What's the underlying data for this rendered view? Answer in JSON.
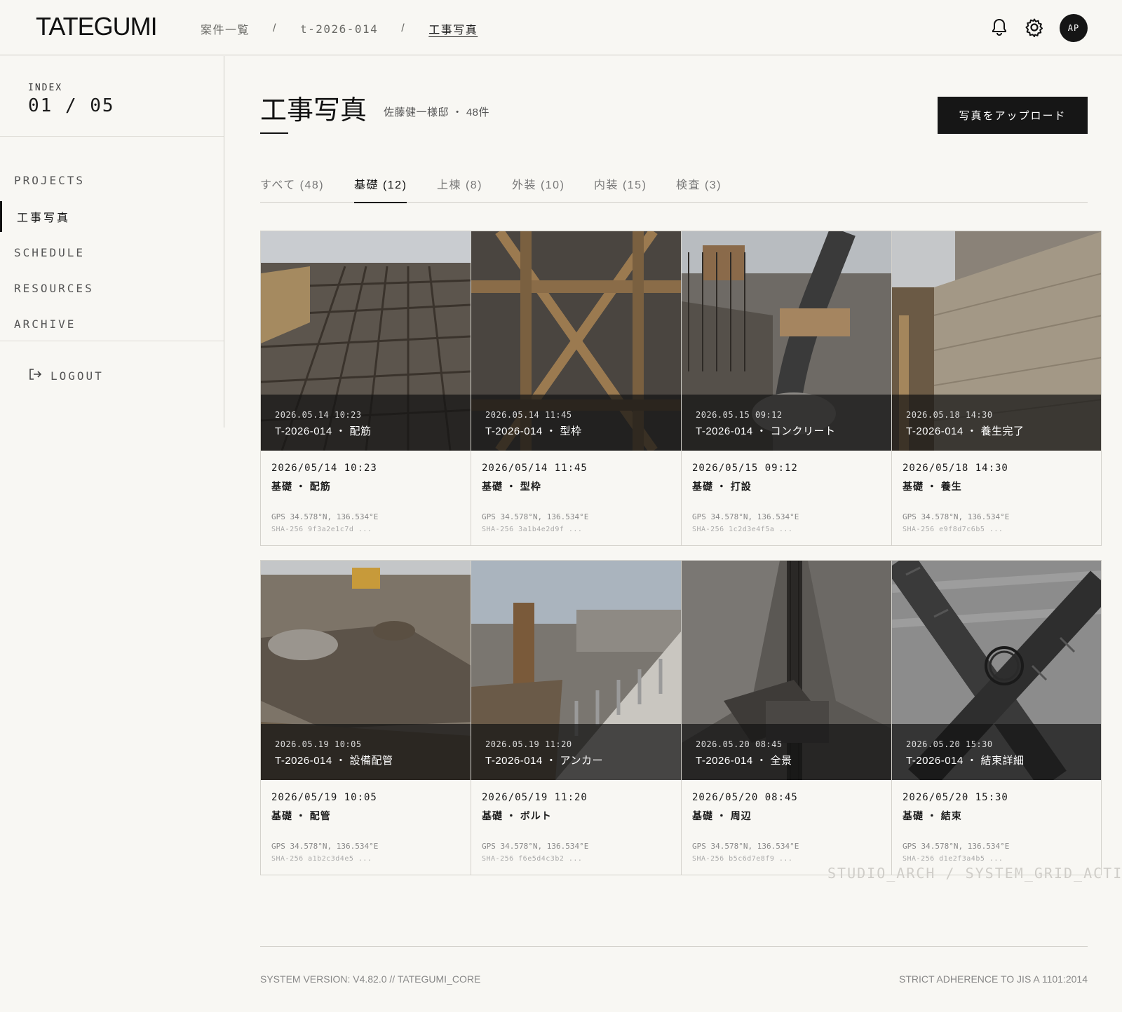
{
  "app": {
    "logo": "TATEGUMI",
    "avatar_initials": "AP"
  },
  "breadcrumb": {
    "items": [
      "案件一覧",
      "t-2026-014",
      "工事写真"
    ],
    "separator": "/"
  },
  "header_icons": [
    "bell-icon",
    "gear-icon"
  ],
  "sidebar": {
    "index_label": "INDEX",
    "index_value": "01 / 05",
    "items": [
      {
        "label": "PROJECTS",
        "active": false
      },
      {
        "label": "工事写真",
        "active": true
      },
      {
        "label": "SCHEDULE",
        "active": false
      },
      {
        "label": "RESOURCES",
        "active": false
      },
      {
        "label": "ARCHIVE",
        "active": false
      }
    ],
    "logout_label": "LOGOUT"
  },
  "page": {
    "title": "工事写真",
    "subtitle": "佐藤健一様邸 ・ 48件",
    "upload_label": "写真をアップロード"
  },
  "tabs": [
    {
      "label": "すべて (48)",
      "active": false
    },
    {
      "label": "基礎 (12)",
      "active": true
    },
    {
      "label": "上棟 (8)",
      "active": false
    },
    {
      "label": "外装 (10)",
      "active": false
    },
    {
      "label": "内装 (15)",
      "active": false
    },
    {
      "label": "検査 (3)",
      "active": false
    }
  ],
  "photos": [
    {
      "overlay_time": "2026.05.14 10:23",
      "overlay_code": "T-2026-014 ・ 配筋",
      "date": "2026/05/14 10:23",
      "category": "基礎 ・ 配筋",
      "gps": "GPS 34.578°N, 136.534°E",
      "sha": "SHA-256 9f3a2e1c7d ..."
    },
    {
      "overlay_time": "2026.05.14 11:45",
      "overlay_code": "T-2026-014 ・ 型枠",
      "date": "2026/05/14 11:45",
      "category": "基礎 ・ 型枠",
      "gps": "GPS 34.578°N, 136.534°E",
      "sha": "SHA-256 3a1b4e2d9f ..."
    },
    {
      "overlay_time": "2026.05.15 09:12",
      "overlay_code": "T-2026-014 ・ コンクリート",
      "date": "2026/05/15 09:12",
      "category": "基礎 ・ 打設",
      "gps": "GPS 34.578°N, 136.534°E",
      "sha": "SHA-256 1c2d3e4f5a ..."
    },
    {
      "overlay_time": "2026.05.18 14:30",
      "overlay_code": "T-2026-014 ・ 養生完了",
      "date": "2026/05/18 14:30",
      "category": "基礎 ・ 養生",
      "gps": "GPS 34.578°N, 136.534°E",
      "sha": "SHA-256 e9f8d7c6b5 ..."
    },
    {
      "overlay_time": "2026.05.19 10:05",
      "overlay_code": "T-2026-014 ・ 設備配管",
      "date": "2026/05/19 10:05",
      "category": "基礎 ・ 配管",
      "gps": "GPS 34.578°N, 136.534°E",
      "sha": "SHA-256 a1b2c3d4e5 ..."
    },
    {
      "overlay_time": "2026.05.19 11:20",
      "overlay_code": "T-2026-014 ・ アンカー",
      "date": "2026/05/19 11:20",
      "category": "基礎 ・ ボルト",
      "gps": "GPS 34.578°N, 136.534°E",
      "sha": "SHA-256 f6e5d4c3b2 ..."
    },
    {
      "overlay_time": "2026.05.20 08:45",
      "overlay_code": "T-2026-014 ・ 全景",
      "date": "2026/05/20 08:45",
      "category": "基礎 ・ 周辺",
      "gps": "GPS 34.578°N, 136.534°E",
      "sha": "SHA-256 b5c6d7e8f9 ..."
    },
    {
      "overlay_time": "2026.05.20 15:30",
      "overlay_code": "T-2026-014 ・ 結束詳細",
      "date": "2026/05/20 15:30",
      "category": "基礎 ・ 結束",
      "gps": "GPS 34.578°N, 136.534°E",
      "sha": "SHA-256 d1e2f3a4b5 ..."
    }
  ],
  "watermark": "STUDIO_ARCH / SYSTEM_GRID_ACTIVE",
  "footer": {
    "left": "SYSTEM VERSION: V4.82.0 // TATEGUMI_CORE",
    "right": "STRICT ADHERENCE TO JIS A 1101:2014"
  },
  "colors": {
    "background": "#f8f7f3",
    "accent": "#161616",
    "border": "#cfcdc7"
  }
}
